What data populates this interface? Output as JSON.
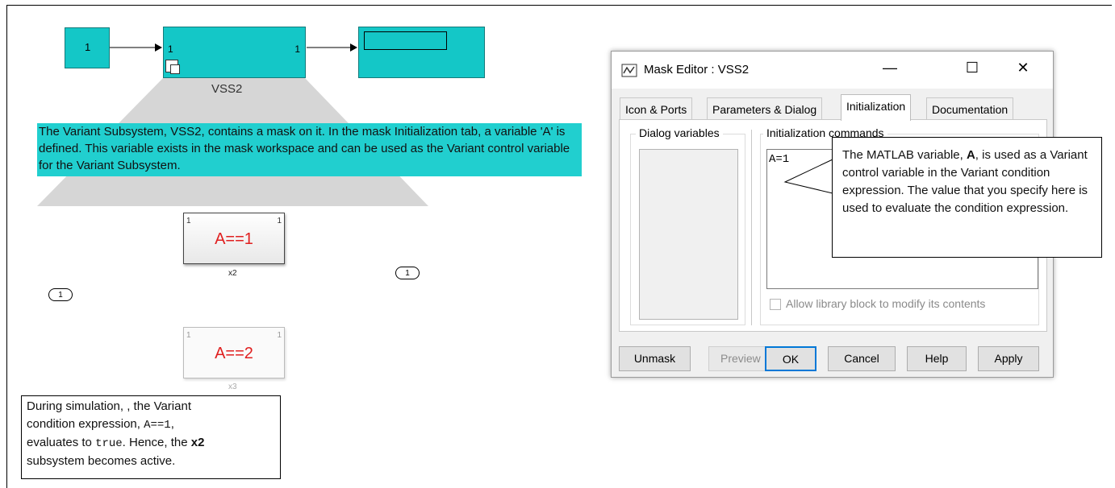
{
  "model": {
    "constant_block": {
      "value": "1"
    },
    "vss_block": {
      "in_port": "1",
      "out_port": "1",
      "name": "VSS2"
    },
    "display_block": {
      "value": ""
    }
  },
  "info_callout": {
    "text": "The Variant Subsystem, VSS2, contains a mask on it. In the mask Initialization tab, a variable 'A' is defined. This variable exists in the mask workspace and can be used as the Variant control variable for the Variant Subsystem."
  },
  "inner_model": {
    "inport_label": "1",
    "outport_label": "1",
    "x2": {
      "condition": "A==1",
      "name": "x2",
      "in_port": "1",
      "out_port": "1"
    },
    "x3": {
      "condition": "A==2",
      "name": "x3",
      "in_port": "1",
      "out_port": "1"
    }
  },
  "note": {
    "line1": "During simulation,  , the Variant",
    "line2a": "condition expression, ",
    "line2_code": "A==1",
    "line2b": ",",
    "line3a": "evaluates to ",
    "line3_code": "true",
    "line3b": ". Hence, the ",
    "line3_bold": "x2",
    "line4": "subsystem becomes active."
  },
  "mask_editor": {
    "title": "Mask Editor : VSS2",
    "minimize": "—",
    "maximize": "☐",
    "close": "✕",
    "tabs": [
      "Icon & Ports",
      "Parameters & Dialog",
      "Initialization",
      "Documentation"
    ],
    "active_tab": "Initialization",
    "dialog_variables_label": "Dialog variables",
    "init_commands_label": "Initialization commands",
    "init_code": "A=1",
    "allow_library_label": "Allow library block to modify its contents",
    "allow_library_checked": false,
    "buttons": {
      "unmask": "Unmask",
      "preview": "Preview",
      "ok": "OK",
      "cancel": "Cancel",
      "help": "Help",
      "apply": "Apply"
    }
  },
  "tooltip": {
    "t1": "The MATLAB variable, ",
    "t_bold": "A",
    "t2": ", is used as a Variant control variable in the Variant condition expression. The value that you specify here is used to evaluate the condition expression."
  },
  "colors": {
    "block_fill": "#14c7c7",
    "callout_fill": "#21cfcf",
    "condition_text": "#e02020",
    "default_button_border": "#0078d7"
  }
}
